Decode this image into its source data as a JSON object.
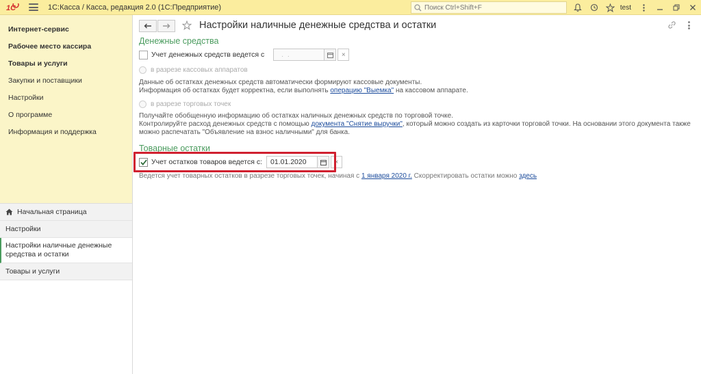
{
  "titlebar": {
    "app_title": "1С:Касса / Касса, редакция 2.0  (1С:Предприятие)",
    "search_placeholder": "Поиск Ctrl+Shift+F",
    "user": "test"
  },
  "sidebar": {
    "sections": [
      {
        "label": "Интернет-сервис",
        "bold": true
      },
      {
        "label": "Рабочее место кассира",
        "bold": true
      },
      {
        "label": "Товары и услуги",
        "bold": true
      },
      {
        "label": "Закупки и поставщики",
        "bold": false
      },
      {
        "label": "Настройки",
        "bold": false
      },
      {
        "label": "О программе",
        "bold": false
      },
      {
        "label": "Информация и поддержка",
        "bold": false
      }
    ],
    "open_windows": {
      "home": "Начальная страница",
      "settings": "Настройки",
      "cash_settings": "Настройки наличные денежные средства и остатки",
      "goods": "Товары и услуги"
    }
  },
  "main": {
    "title": "Настройки наличные денежные средства и остатки",
    "cash": {
      "section_title": "Денежные средства",
      "checkbox_label": "Учет денежных средств ведется с",
      "checkbox_checked": false,
      "date_value": "  .  .",
      "radio_devices": "в разрезе кассовых аппаратов",
      "devices_info_1": "Данные об остатках денежных средств автоматически формируют кассовые документы.",
      "devices_info_2_pre": "Информация об остатках будет корректна, если выполнять ",
      "devices_info_2_link": "операцию \"Выемка\"",
      "devices_info_2_post": " на кассовом аппарате.",
      "radio_points": "в разрезе торговых точек",
      "points_info_1": "Получайте обобщенную информацию об остатках наличных денежных средств по торговой точке.",
      "points_info_2_pre": "Контролируйте расход денежных средств с помощью ",
      "points_info_2_link": "документа \"Снятие выручки\"",
      "points_info_2_post": ", который можно создать из карточки торговой точки. На основании этого документа также",
      "points_info_3": "можно распечатать \"Объявление на взнос наличными\" для банка."
    },
    "goods": {
      "section_title": "Товарные остатки",
      "checkbox_label": "Учет остатков товаров ведется с:",
      "checkbox_checked": true,
      "date_value": "01.01.2020",
      "info_pre": "Ведется учет товарных остатков в разрезе торговых точек, начиная с ",
      "info_date_link": "1 января 2020 г.",
      "info_mid": " Скорректировать остатки можно ",
      "info_here_link": "здесь"
    }
  },
  "colors": {
    "titlebar_bg": "#fbed9e",
    "sidebar_bg": "#fbf5c8",
    "section_green": "#4a9b5e",
    "link_blue": "#1c4c9c",
    "highlight_red": "#d0202f"
  },
  "icons": [
    "1c-logo-icon",
    "menu-icon",
    "search-icon",
    "bell-icon",
    "history-icon",
    "star-icon",
    "user-menu-icon",
    "minimize-icon",
    "restore-icon",
    "close-icon",
    "back-arrow-icon",
    "forward-arrow-icon",
    "link-icon",
    "more-icon",
    "calendar-icon",
    "clear-icon",
    "home-icon",
    "check-icon"
  ]
}
